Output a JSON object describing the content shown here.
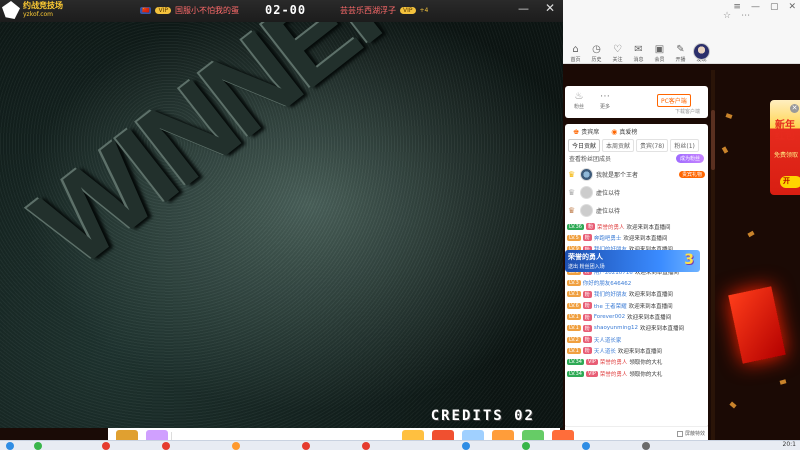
{
  "game": {
    "logo_line1": "约战竞技场",
    "logo_line2": "yzkof.com",
    "player1": {
      "flag": "🇨🇳",
      "badge": "VIP",
      "name": "国服小不怕我的蛋"
    },
    "score": "02-00",
    "player2": {
      "name": "芸芸乐西湖浮子",
      "badge": "VIP",
      "tag": "+4"
    },
    "minimize_icon": "—",
    "close_icon": "✕",
    "screen_text": "WINNER",
    "credits": "CREDITS 02"
  },
  "browser": {
    "window_buttons": [
      "≡",
      "—",
      "▢",
      "✕"
    ],
    "toolbar_right": [
      "☆",
      "⋯"
    ],
    "nav_tools": [
      {
        "icon": "⌂",
        "label": "首页"
      },
      {
        "icon": "◷",
        "label": "历史"
      },
      {
        "icon": "♡",
        "label": "关注"
      },
      {
        "icon": "✉",
        "label": "消息",
        "dot": ""
      },
      {
        "icon": "▣",
        "label": "会员",
        "dot": ""
      },
      {
        "icon": "✎",
        "label": "开播"
      },
      {
        "icon": "⚲",
        "label": "发现"
      }
    ]
  },
  "host_card": {
    "items": [
      {
        "icon": "♨",
        "label": "粉丝"
      },
      {
        "icon": "⋯",
        "label": "更多"
      }
    ],
    "pc_live": "PC客户端",
    "desktop": "下载客户端"
  },
  "chat": {
    "top_pills": [
      {
        "icon": "♚",
        "label": "贵宾席"
      },
      {
        "icon": "◉",
        "label": "真爱榜"
      }
    ],
    "tabs": [
      "今日贡献",
      "本周贡献",
      "贵宾(78)",
      "粉丝(1)"
    ],
    "fans_text": "查看粉丝团成员",
    "become_fan": "成为粉丝",
    "ranks": [
      {
        "crown": "♛",
        "name": "我就是那个王者",
        "gift": "贵宾礼物"
      },
      {
        "crown": "♛",
        "name": "虚位以待"
      },
      {
        "crown": "♛",
        "name": "虚位以待"
      }
    ],
    "messages": [
      {
        "lv": "LV.36",
        "medal": "粉",
        "user": "荣誉的勇人",
        "text": "欢迎来到本直播间",
        "red": true
      },
      {
        "lv": "LV.5",
        "medal": "粉",
        "user": "奔跑吧勇士",
        "text": "欢迎来到本直播间"
      },
      {
        "lv": "LV.9",
        "medal": "粉",
        "user": "我们的好朋友",
        "text": "欢迎来到本直播间"
      },
      {
        "lv": "LV.2",
        "medal": "粉",
        "user": "37 - 爱游戏",
        "text": "欢迎来到本直播间"
      },
      {
        "lv": "LV.5",
        "medal": "粉",
        "user": "用户20210716",
        "text": "欢迎来到本直播间"
      },
      {
        "lv": "LV.3",
        "medal": "",
        "user": "你好的朋友646462",
        "text": ""
      },
      {
        "lv": "LV.1",
        "medal": "粉",
        "user": "我们的好朋友",
        "text": "欢迎来到本直播间"
      },
      {
        "lv": "LV.6",
        "medal": "粉",
        "user": "the 王者荣耀",
        "text": "欢迎来到本直播间"
      },
      {
        "lv": "LV.1",
        "medal": "粉",
        "user": "Forever002",
        "text": "欢迎来到本直播间"
      },
      {
        "lv": "LV.1",
        "medal": "粉",
        "user": "shaoyunming12",
        "text": "欢迎来到本直播间"
      },
      {
        "lv": "LV.2",
        "medal": "粉",
        "user": "天人道长家",
        "text": ""
      },
      {
        "lv": "LV.1",
        "medal": "粉",
        "user": "天人道长",
        "text": "欢迎来到本直播间"
      },
      {
        "lv": "LV.34",
        "medal": "VIP",
        "user": "荣誉的勇人",
        "text": "领取你的大礼",
        "red": true
      },
      {
        "lv": "LV.34",
        "medal": "VIP",
        "user": "荣誉的勇人",
        "text": "领取你的大礼",
        "red": true
      }
    ],
    "input_placeholder": "☺",
    "filter_label": "屏蔽特效"
  },
  "promo": {
    "line1": "荣誉的勇人",
    "line2": "送出  粉丝团入场",
    "big": "3"
  },
  "redpack": {
    "title": "新年红包",
    "sub": "免费领取",
    "button": "开",
    "close": "✕"
  },
  "giftbar": {
    "colors": [
      "#e0a030",
      "#d0a0ff",
      "#ffc040",
      "#f05030",
      "#a0d0ff",
      "#ff9d3a",
      "#66cc66",
      "#ff6d3a"
    ]
  },
  "taskbar": {
    "clock": "20:1"
  },
  "colors": {
    "accent": "#ff6600",
    "title_name": "#ff6b6b",
    "gold": "#f3c23d"
  }
}
